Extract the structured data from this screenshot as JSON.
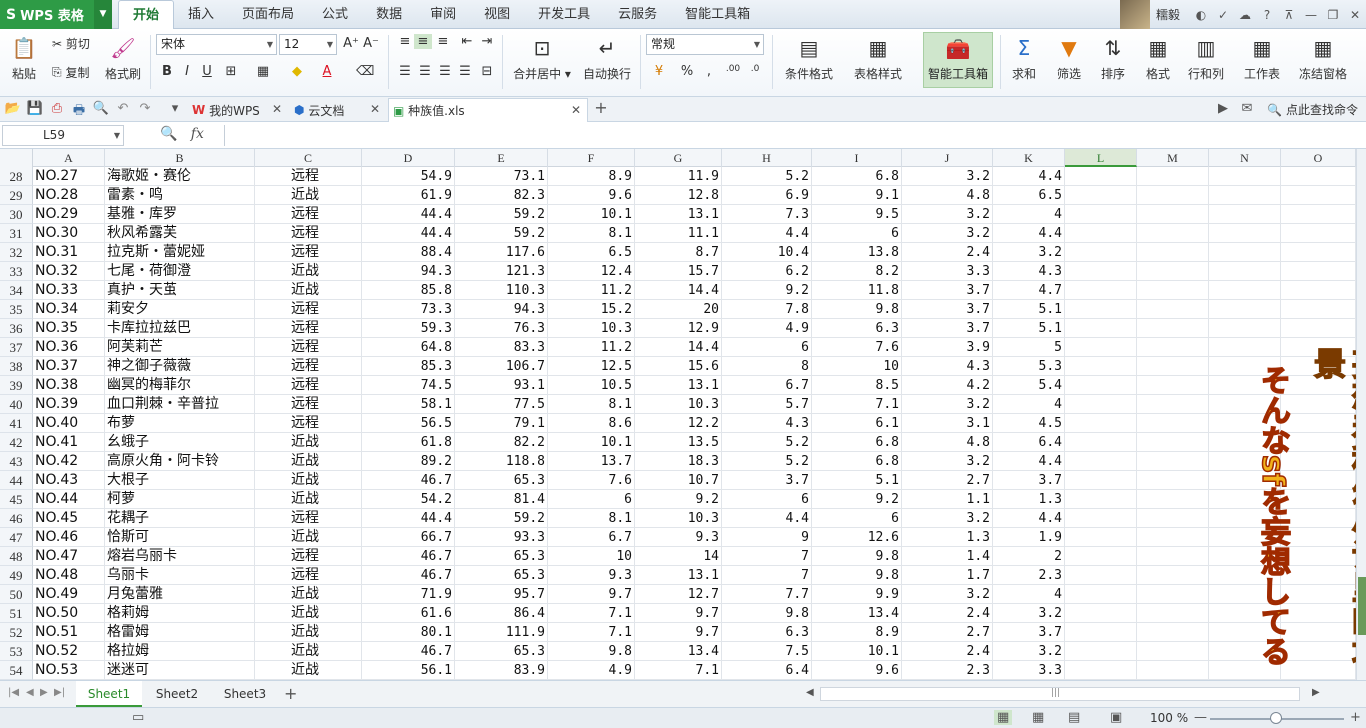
{
  "app": {
    "brand": "WPS 表格",
    "menu_tabs": [
      "开始",
      "插入",
      "页面布局",
      "公式",
      "数据",
      "审阅",
      "视图",
      "开发工具",
      "云服务",
      "智能工具箱"
    ],
    "active_menu": "开始",
    "user": "糯毅"
  },
  "ribbon": {
    "paste": "粘贴",
    "cut": "剪切",
    "copy": "复制",
    "format_painter": "格式刷",
    "font_name": "宋体",
    "font_size": "12",
    "merge_center": "合并居中",
    "wrap_text": "自动换行",
    "number_format": "常规",
    "conditional_format": "条件格式",
    "table_style": "表格样式",
    "smart_toolbox": "智能工具箱",
    "sum": "求和",
    "filter": "筛选",
    "sort": "排序",
    "format": "格式",
    "rows_cols": "行和列",
    "worksheet": "工作表",
    "freeze": "冻结窗格",
    "accent": "#2e9b46"
  },
  "docbar": {
    "tabs": [
      {
        "label": "我的WPS"
      },
      {
        "label": "云文档"
      },
      {
        "label": "种族值.xls"
      }
    ],
    "search": "点此查找命令"
  },
  "formula": {
    "name_box": "L59",
    "fx": "fx",
    "value": ""
  },
  "columns": [
    "A",
    "B",
    "C",
    "D",
    "E",
    "F",
    "G",
    "H",
    "I",
    "J",
    "K",
    "L",
    "M",
    "N",
    "O"
  ],
  "selected_column": "L",
  "rows": [
    {
      "n": "28",
      "cells": [
        "NO.27",
        "海歌姬・赛伦",
        "远程",
        "54.9",
        "73.1",
        "8.9",
        "11.9",
        "5.2",
        "6.8",
        "3.2",
        "4.4"
      ]
    },
    {
      "n": "29",
      "cells": [
        "NO.28",
        "雷素・鸣",
        "近战",
        "61.9",
        "82.3",
        "9.6",
        "12.8",
        "6.9",
        "9.1",
        "4.8",
        "6.5"
      ]
    },
    {
      "n": "30",
      "cells": [
        "NO.29",
        "基雅・库罗",
        "远程",
        "44.4",
        "59.2",
        "10.1",
        "13.1",
        "7.3",
        "9.5",
        "3.2",
        "4"
      ]
    },
    {
      "n": "31",
      "cells": [
        "NO.30",
        "秋风希露芙",
        "远程",
        "44.4",
        "59.2",
        "8.1",
        "11.1",
        "4.4",
        "6",
        "3.2",
        "4.4"
      ]
    },
    {
      "n": "32",
      "cells": [
        "NO.31",
        "拉克斯・蕾妮娅",
        "远程",
        "88.4",
        "117.6",
        "6.5",
        "8.7",
        "10.4",
        "13.8",
        "2.4",
        "3.2"
      ]
    },
    {
      "n": "33",
      "cells": [
        "NO.32",
        "七尾・荷御澄",
        "近战",
        "94.3",
        "121.3",
        "12.4",
        "15.7",
        "6.2",
        "8.2",
        "3.3",
        "4.3"
      ]
    },
    {
      "n": "34",
      "cells": [
        "NO.33",
        "真护・天茧",
        "近战",
        "85.8",
        "110.3",
        "11.2",
        "14.4",
        "9.2",
        "11.8",
        "3.7",
        "4.7"
      ]
    },
    {
      "n": "35",
      "cells": [
        "NO.34",
        "莉安夕",
        "远程",
        "73.3",
        "94.3",
        "15.2",
        "20",
        "7.8",
        "9.8",
        "3.7",
        "5.1"
      ]
    },
    {
      "n": "36",
      "cells": [
        "NO.35",
        "卡库拉拉兹巴",
        "远程",
        "59.3",
        "76.3",
        "10.3",
        "12.9",
        "4.9",
        "6.3",
        "3.7",
        "5.1"
      ]
    },
    {
      "n": "37",
      "cells": [
        "NO.36",
        "阿芙莉芒",
        "远程",
        "64.8",
        "83.3",
        "11.2",
        "14.4",
        "6",
        "7.6",
        "3.9",
        "5"
      ]
    },
    {
      "n": "38",
      "cells": [
        "NO.37",
        "神之御子薇薇",
        "远程",
        "85.3",
        "106.7",
        "12.5",
        "15.6",
        "8",
        "10",
        "4.3",
        "5.3"
      ]
    },
    {
      "n": "39",
      "cells": [
        "NO.38",
        "幽冥的梅菲尔",
        "远程",
        "74.5",
        "93.1",
        "10.5",
        "13.1",
        "6.7",
        "8.5",
        "4.2",
        "5.4"
      ]
    },
    {
      "n": "40",
      "cells": [
        "NO.39",
        "血口荆棘・辛普拉",
        "远程",
        "58.1",
        "77.5",
        "8.1",
        "10.3",
        "5.7",
        "7.1",
        "3.2",
        "4"
      ]
    },
    {
      "n": "41",
      "cells": [
        "NO.40",
        "布萝",
        "远程",
        "56.5",
        "79.1",
        "8.6",
        "12.2",
        "4.3",
        "6.1",
        "3.1",
        "4.5"
      ]
    },
    {
      "n": "42",
      "cells": [
        "NO.41",
        "幺蛾子",
        "近战",
        "61.8",
        "82.2",
        "10.1",
        "13.5",
        "5.2",
        "6.8",
        "4.8",
        "6.4"
      ]
    },
    {
      "n": "43",
      "cells": [
        "NO.42",
        "高原火角・阿卡铃",
        "近战",
        "89.2",
        "118.8",
        "13.7",
        "18.3",
        "5.2",
        "6.8",
        "3.2",
        "4.4"
      ]
    },
    {
      "n": "44",
      "cells": [
        "NO.43",
        "大根子",
        "近战",
        "46.7",
        "65.3",
        "7.6",
        "10.7",
        "3.7",
        "5.1",
        "2.7",
        "3.7"
      ]
    },
    {
      "n": "45",
      "cells": [
        "NO.44",
        "柯萝",
        "近战",
        "54.2",
        "81.4",
        "6",
        "9.2",
        "6",
        "9.2",
        "1.1",
        "1.3"
      ]
    },
    {
      "n": "46",
      "cells": [
        "NO.45",
        "花耦子",
        "远程",
        "44.4",
        "59.2",
        "8.1",
        "10.3",
        "4.4",
        "6",
        "3.2",
        "4.4"
      ]
    },
    {
      "n": "47",
      "cells": [
        "NO.46",
        "恰斯可",
        "近战",
        "66.7",
        "93.3",
        "6.7",
        "9.3",
        "9",
        "12.6",
        "1.3",
        "1.9"
      ]
    },
    {
      "n": "48",
      "cells": [
        "NO.47",
        "熔岩乌丽卡",
        "远程",
        "46.7",
        "65.3",
        "10",
        "14",
        "7",
        "9.8",
        "1.4",
        "2"
      ]
    },
    {
      "n": "49",
      "cells": [
        "NO.48",
        "乌丽卡",
        "远程",
        "46.7",
        "65.3",
        "9.3",
        "13.1",
        "7",
        "9.8",
        "1.7",
        "2.3"
      ]
    },
    {
      "n": "50",
      "cells": [
        "NO.49",
        "月兔蕾雅",
        "近战",
        "71.9",
        "95.7",
        "9.7",
        "12.7",
        "7.7",
        "9.9",
        "3.2",
        "4"
      ]
    },
    {
      "n": "51",
      "cells": [
        "NO.50",
        "格莉姆",
        "近战",
        "61.6",
        "86.4",
        "7.1",
        "9.7",
        "9.8",
        "13.4",
        "2.4",
        "3.2"
      ]
    },
    {
      "n": "52",
      "cells": [
        "NO.51",
        "格雷姆",
        "近战",
        "80.1",
        "111.9",
        "7.1",
        "9.7",
        "6.3",
        "8.9",
        "2.7",
        "3.7"
      ]
    },
    {
      "n": "53",
      "cells": [
        "NO.52",
        "格拉姆",
        "近战",
        "46.7",
        "65.3",
        "9.8",
        "13.4",
        "7.5",
        "10.1",
        "2.4",
        "3.2"
      ]
    },
    {
      "n": "54",
      "cells": [
        "NO.53",
        "迷迷可",
        "近战",
        "56.1",
        "83.9",
        "4.9",
        "7.1",
        "6.4",
        "9.6",
        "2.3",
        "3.3"
      ]
    }
  ],
  "overlay": {
    "cn": "妄想着科幻小说里的场景",
    "jp": "そんなsfを妄想してる"
  },
  "sheets": [
    "Sheet1",
    "Sheet2",
    "Sheet3"
  ],
  "active_sheet": "Sheet1",
  "status": {
    "zoom": "100 %",
    "zoom_level_percent": 100
  }
}
